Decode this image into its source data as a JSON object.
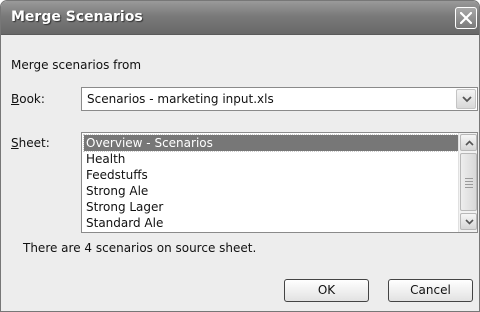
{
  "window": {
    "title": "Merge Scenarios"
  },
  "merge_from_label": "Merge scenarios from",
  "book": {
    "label_key": "B",
    "label_rest": "ook:",
    "value": "Scenarios - marketing input.xls"
  },
  "sheet": {
    "label_key": "S",
    "label_rest": "heet:",
    "items": [
      "Overview - Scenarios",
      "Health",
      "Feedstuffs",
      "Strong Ale",
      "Strong Lager",
      "Standard Ale"
    ],
    "selected_index": 0
  },
  "status_text": "There are 4 scenarios on source sheet.",
  "buttons": {
    "ok": "OK",
    "cancel": "Cancel"
  },
  "icons": {
    "close": "close-icon",
    "dropdown": "chevron-down-icon",
    "scroll_up": "arrow-up-icon",
    "scroll_down": "arrow-down-icon"
  }
}
